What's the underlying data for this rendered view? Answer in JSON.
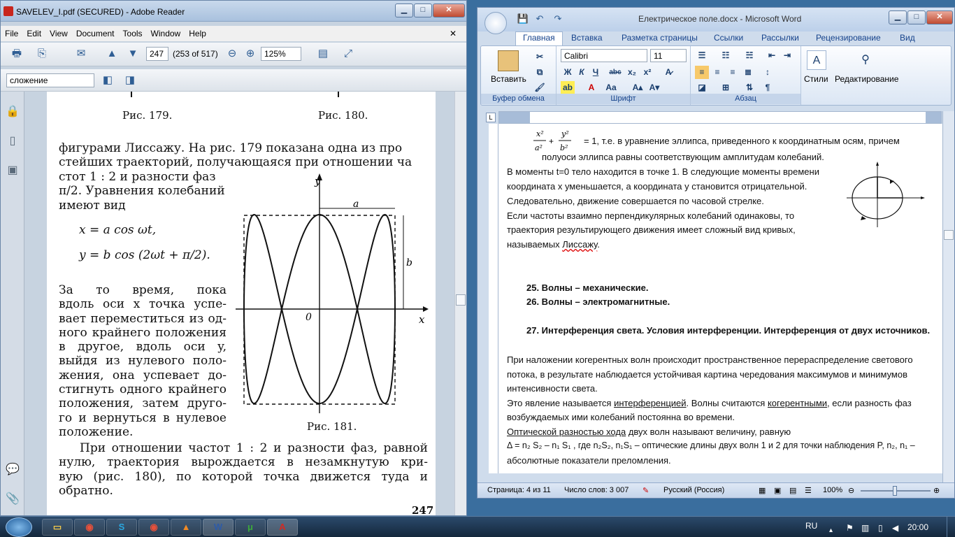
{
  "adobe": {
    "title": "SAVELEV_I.pdf (SECURED) - Adobe Reader",
    "menu": [
      "File",
      "Edit",
      "View",
      "Document",
      "Tools",
      "Window",
      "Help"
    ],
    "page_input": "247",
    "page_count": "(253 of 517)",
    "zoom": "125%",
    "search_value": "сложение",
    "pdf": {
      "caption_179": "Рис. 179.",
      "caption_180": "Рис. 180.",
      "caption_181": "Рис. 181.",
      "line_1": "фигурами Лиссажу. На рис. 179 показана одна из про",
      "line_2": "стейших траекторий, получающаяся при отношении ча",
      "line_3": "стот  1 : 2  и  разности  фаз",
      "line_4": "π/2. Уравнения колебаний",
      "line_5": "имеют вид",
      "eq_1": "x = a cos ωt,",
      "eq_2": "y = b cos (2ωt + π/2).",
      "p2": [
        "За   то   время,   пока",
        "вдоль оси  x  точка  успе-",
        "вает переместиться из од-",
        "ного крайнего положения",
        "в   другое,   вдоль   оси   y,",
        "выйдя  из  нулевого  поло-",
        "жения,  она  успевает  до-",
        "стигнуть одного крайнего",
        "положения,  затем  друго-",
        "го и вернуться в нулевое",
        "положение."
      ],
      "p3": [
        "При отношении частот 1 : 2 и разности фаз, равной",
        "нулю,   траектория   вырождается   в   незамкнутую  кри-",
        "вую  (рис.  180),   по  которой  точка  движется  туда  и",
        "обратно."
      ],
      "page_number": "247",
      "axis_y": "y",
      "axis_x": "x",
      "axis_o": "0",
      "axis_a": "a",
      "axis_b": "b"
    }
  },
  "word": {
    "title": "Електрическое поле.docx - Microsoft Word",
    "tabs": [
      "Главная",
      "Вставка",
      "Разметка страницы",
      "Ссылки",
      "Рассылки",
      "Рецензирование",
      "Вид"
    ],
    "font_name": "Calibri",
    "font_size": "11",
    "groups": {
      "clipboard": "Буфер обмена",
      "font": "Шрифт",
      "paragraph": "Абзац"
    },
    "paste_label": "Вставить",
    "styles_label": "Стили",
    "editing_label": "Редактирование",
    "doc": {
      "line_eq_suffix": "= 1, т.е. в уравнение эллипса, приведенного к координатным осям, причем",
      "line_eq_2": "полуоси эллипса равны соответствующим амплитудам колебаний.",
      "l1": "В моменты t=0 тело находится в точке 1. В следующие моменты времени",
      "l2": "координата x уменьшается, а координата y становится отрицательной.",
      "l3": "Следовательно, движение совершается по часовой стрелке.",
      "l4": "Если частоты взаимно перпендикулярных колебаний одинаковы, то",
      "l5": "траектория результирующего движения имеет сложный вид кривых,",
      "l6_a": "называемых ",
      "l6_b": "Лиссажу",
      "l6_c": ".",
      "h25": "25.  Волны – механические.",
      "h26": "26.  Волны – электромагнитные.",
      "h27": "27.  Интерференция света. Условия интерференции. Интерференция от двух источников.",
      "p1": "При наложении когерентных волн происходит пространственное перераспределение светового",
      "p2": "потока, в результате наблюдается устойчивая картина чередования максимумов и минимумов",
      "p3": "интенсивности света.",
      "p4a": "Это явление называется ",
      "p4b": "интерференцией",
      "p4c": ". Волны считаются ",
      "p4d": "когерентными",
      "p4e": ",  если разность фаз",
      "p5": "возбуждаемых ими колебаний постоянна во времени.",
      "p6a": "Оптической разностью хода",
      "p6b": " двух волн называют величину, равную",
      "p7": "Δ = n₂ S₂ – n₁ S₁ , где n₂S₂, n₁S₁ – оптические длины двух волн 1 и 2 для точки наблюдения P, n₂, n₁ –",
      "p8": "абсолютные показатели преломления."
    },
    "status": {
      "page": "Страница: 4 из 11",
      "words": "Число слов: 3 007",
      "lang": "Русский (Россия)",
      "zoom": "100%"
    }
  },
  "taskbar": {
    "lang": "RU",
    "time": "20:00"
  }
}
